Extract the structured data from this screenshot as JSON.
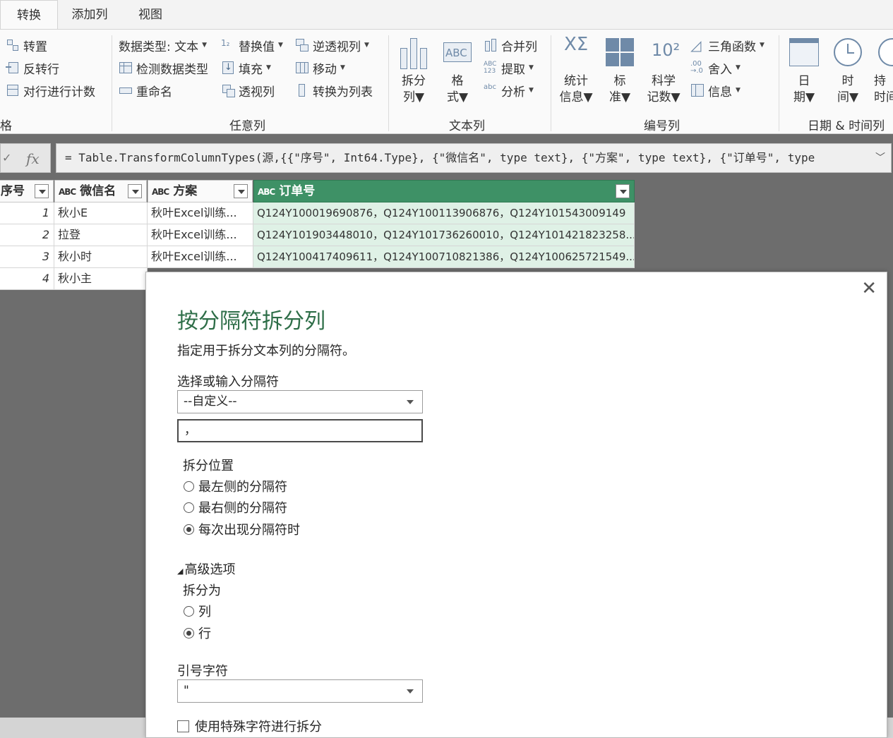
{
  "tabs": [
    "转换",
    "添加列",
    "视图"
  ],
  "ribbon": {
    "table_group": {
      "items": [
        "转置",
        "反转行",
        "对行进行计数"
      ],
      "label": "格"
    },
    "any_column_group": {
      "data_type": "数据类型: 文本",
      "detect_type": "检测数据类型",
      "rename": "重命名",
      "replace_values": "替换值",
      "fill": "填充",
      "pivot": "透视列",
      "unpivot": "逆透视列",
      "move": "移动",
      "to_list": "转换为列表",
      "label": "任意列"
    },
    "text_group": {
      "split_top": "拆分",
      "split_bottom": "列",
      "format_top": "格",
      "format_bottom": "式",
      "merge": "合并列",
      "extract": "提取",
      "parse": "分析",
      "label": "文本列"
    },
    "number_group": {
      "stats_top": "统计",
      "stats_bottom": "信息",
      "standard_top": "标",
      "standard_bottom": "准",
      "sci_top": "科学",
      "sci_bottom": "记数",
      "trig": "三角函数",
      "round": "舍入",
      "info": "信息",
      "label": "编号列"
    },
    "datetime_group": {
      "date_top": "日",
      "date_bottom": "期",
      "time_top": "时",
      "time_bottom": "间",
      "dur_top": "持",
      "dur_bottom": "时间",
      "label": "日期 & 时间列"
    }
  },
  "formula": "= Table.TransformColumnTypes(源,{{\"序号\", Int64.Type}, {\"微信名\", type text}, {\"方案\", type text}, {\"订单号\", type",
  "grid": {
    "headers": [
      "序号",
      "微信名",
      "方案",
      "订单号"
    ],
    "abc": "ABC",
    "rows": [
      {
        "idx": "1",
        "name": "秋小E",
        "plan": "秋叶Excel训练...",
        "order": "Q124Y100019690876，Q124Y100113906876，Q124Y101543009149"
      },
      {
        "idx": "2",
        "name": "拉登",
        "plan": "秋叶Excel训练...",
        "order": "Q124Y101903448010，Q124Y101736260010，Q124Y101421823258..."
      },
      {
        "idx": "3",
        "name": "秋小时",
        "plan": "秋叶Excel训练...",
        "order": "Q124Y100417409611，Q124Y100710821386，Q124Y100625721549..."
      },
      {
        "idx": "4",
        "name": "秋小主",
        "plan": "",
        "order": ""
      }
    ]
  },
  "dialog": {
    "title": "按分隔符拆分列",
    "subtitle": "指定用于拆分文本列的分隔符。",
    "delimiter_label": "选择或输入分隔符",
    "delimiter_value": "--自定义--",
    "custom_value": "，",
    "position_label": "拆分位置",
    "positions": [
      "最左侧的分隔符",
      "最右侧的分隔符",
      "每次出现分隔符时"
    ],
    "advanced": "高级选项",
    "split_into_label": "拆分为",
    "split_into": [
      "列",
      "行"
    ],
    "quote_label": "引号字符",
    "quote_value": "\"",
    "special_chars": "使用特殊字符进行拆分"
  }
}
